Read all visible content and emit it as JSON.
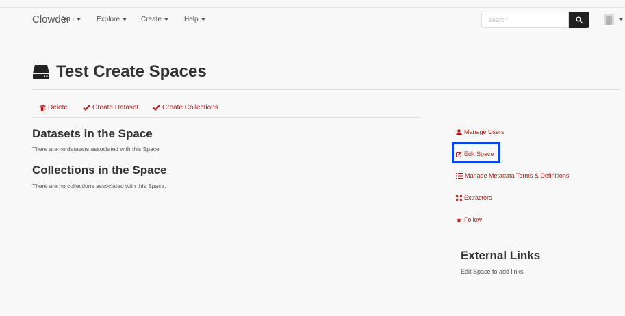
{
  "navbar": {
    "brand": "Clowder",
    "menus": [
      "You",
      "Explore",
      "Create",
      "Help"
    ],
    "search_placeholder": "Search"
  },
  "space": {
    "title": "Test Create Spaces",
    "actions": [
      "Delete",
      "Create Dataset",
      "Create Collections"
    ]
  },
  "datasets": {
    "heading": "Datasets in the Space",
    "empty_text": "There are no datasets associated with this Space"
  },
  "collections": {
    "heading": "Collections in the Space",
    "empty_text": "There are no collections associated with this Space."
  },
  "sidebar": {
    "links": [
      "Manage Users",
      "Edit Space",
      "Manage Metadata Terms & Definitions",
      "Extractors",
      "Follow"
    ]
  },
  "external_links": {
    "heading": "External Links",
    "text": "Edit Space to add links"
  },
  "colors": {
    "accent": "#b71c1c",
    "highlight": "#0a47e6",
    "navbar_bg": "#f8f8f8"
  }
}
